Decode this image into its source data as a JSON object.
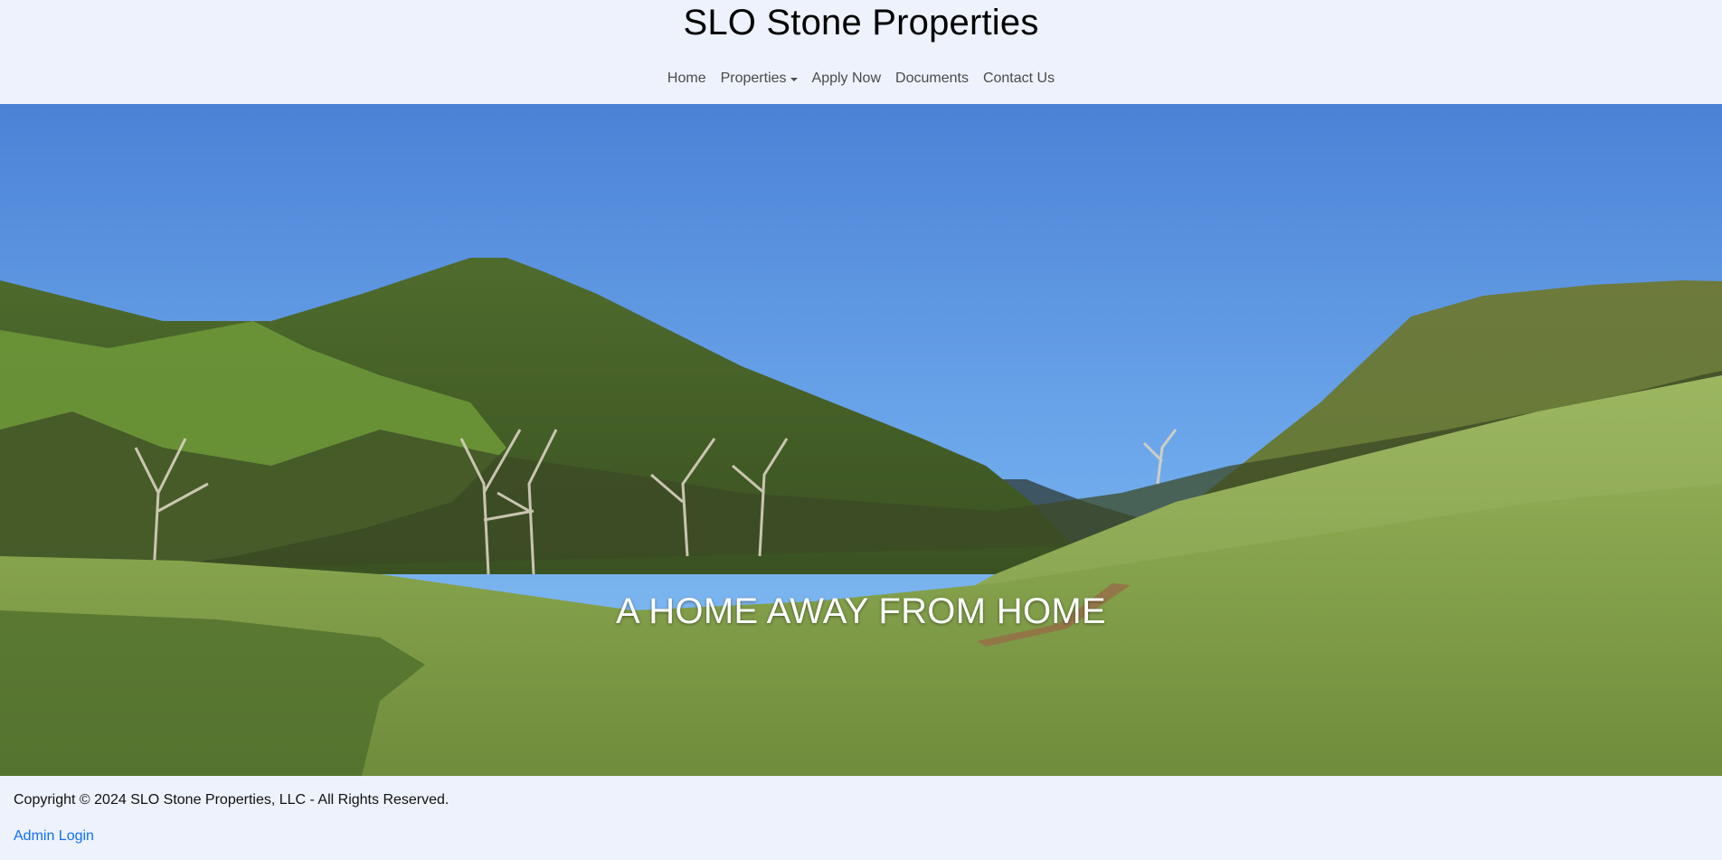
{
  "header": {
    "title": "SLO Stone Properties",
    "nav": {
      "home": "Home",
      "properties": "Properties",
      "apply": "Apply Now",
      "documents": "Documents",
      "contact": "Contact Us"
    }
  },
  "hero": {
    "tagline": "A HOME AWAY FROM HOME",
    "image_description_icon": "landscape-photo"
  },
  "footer": {
    "copyright": "Copyright © 2024 SLO Stone Properties, LLC - All Rights Reserved.",
    "admin_login": "Admin Login"
  },
  "colors": {
    "background": "#eef2fc",
    "link": "#0d6efd",
    "sky_top": "#4f86d8",
    "sky_bottom": "#86bff0",
    "grass": "#7fa84a"
  }
}
